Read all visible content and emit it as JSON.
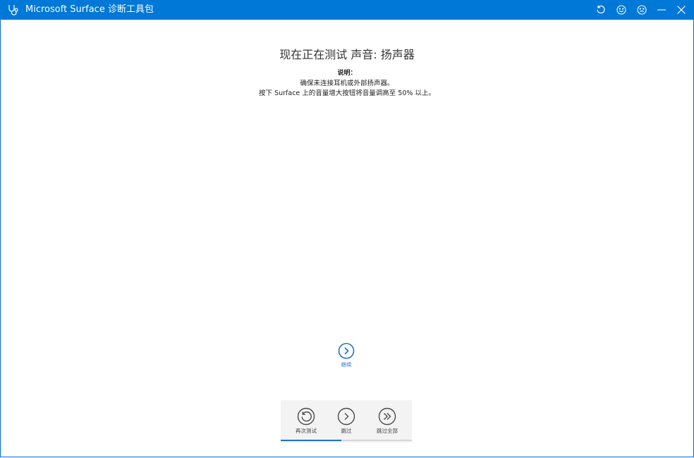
{
  "window": {
    "title": "Microsoft Surface 诊断工具包",
    "accent_color": "#0078d7",
    "title_icons": [
      "refresh-icon",
      "smile-icon",
      "frown-icon",
      "minimize-icon",
      "close-icon"
    ]
  },
  "test": {
    "heading": "现在正在测试 声音: 扬声器",
    "instructions_label": "说明：",
    "instructions": [
      "确保未连接耳机或外部扬声器。",
      "按下 Surface 上的音量增大按钮将音量调高至 50% 以上。"
    ]
  },
  "continue": {
    "label": "继续",
    "icon": "chevron-right-circle-icon"
  },
  "controls": {
    "retest": {
      "label": "再次测试",
      "icon": "retry-icon"
    },
    "skip": {
      "label": "跳过",
      "icon": "chevron-right-circle-icon"
    },
    "skip_all": {
      "label": "跳过全部",
      "icon": "double-chevron-right-circle-icon"
    }
  },
  "progress": {
    "fraction": 0.46
  }
}
